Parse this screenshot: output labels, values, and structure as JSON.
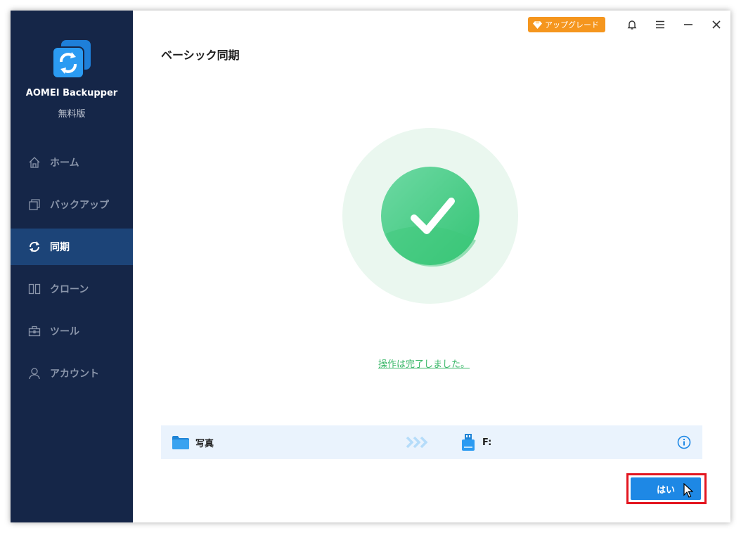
{
  "app": {
    "name": "AOMEI Backupper",
    "edition": "無料版"
  },
  "sidebar": {
    "items": [
      {
        "label": "ホーム",
        "icon": "home-icon",
        "active": false
      },
      {
        "label": "バックアップ",
        "icon": "backup-icon",
        "active": false
      },
      {
        "label": "同期",
        "icon": "sync-icon",
        "active": true
      },
      {
        "label": "クローン",
        "icon": "clone-icon",
        "active": false
      },
      {
        "label": "ツール",
        "icon": "tools-icon",
        "active": false
      },
      {
        "label": "アカウント",
        "icon": "account-icon",
        "active": false
      }
    ]
  },
  "topbar": {
    "upgrade_label": "アップグレード"
  },
  "main": {
    "title": "ベーシック同期",
    "status_text": "操作は完了しました。",
    "task": {
      "source": "写真",
      "destination": "F:"
    },
    "ok_label": "はい"
  },
  "colors": {
    "sidebar_bg": "#152648",
    "sidebar_active": "#1c4478",
    "accent": "#1e88e5",
    "success": "#3cb86a",
    "upgrade": "#f5961e",
    "highlight": "#e3151f"
  }
}
